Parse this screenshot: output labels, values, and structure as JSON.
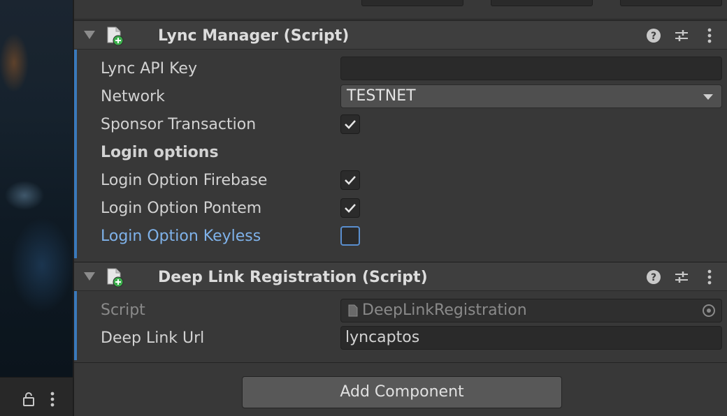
{
  "scene_bar": {
    "icons": [
      "lock-icon",
      "kebab-menu-icon"
    ]
  },
  "components": [
    {
      "title": "Lync Manager (Script)",
      "header_icons": [
        "help-icon",
        "preset-sliders-icon",
        "kebab-menu-icon"
      ],
      "fields": {
        "api_key": {
          "label": "Lync API Key",
          "value": ""
        },
        "network": {
          "label": "Network",
          "value": "TESTNET"
        },
        "sponsor": {
          "label": "Sponsor Transaction",
          "checked": true
        },
        "section_label": "Login options",
        "firebase": {
          "label": "Login Option Firebase",
          "checked": true
        },
        "pontem": {
          "label": "Login Option Pontem",
          "checked": true
        },
        "keyless": {
          "label": "Login Option Keyless",
          "checked": false
        }
      }
    },
    {
      "title": "Deep Link Registration (Script)",
      "header_icons": [
        "help-icon",
        "preset-sliders-icon",
        "kebab-menu-icon"
      ],
      "fields": {
        "script": {
          "label": "Script",
          "value": "DeepLinkRegistration"
        },
        "url": {
          "label": "Deep Link Url",
          "value": "lyncaptos"
        }
      }
    }
  ],
  "add_component_label": "Add Component",
  "colors": {
    "accent": "#3a79bb",
    "modified_label": "#7fb2ea",
    "background": "#383838"
  }
}
